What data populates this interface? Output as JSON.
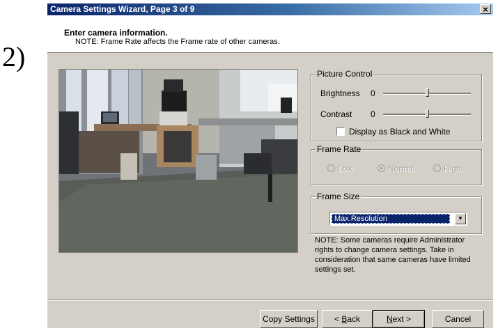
{
  "step_label": "2)",
  "window": {
    "title": "Camera Settings Wizard, Page 3 of 9",
    "close_glyph": "×"
  },
  "header": {
    "heading": "Enter camera information.",
    "note": "NOTE: Frame Rate affects the Frame rate of other cameras."
  },
  "picture_control": {
    "legend": "Picture Control",
    "brightness_label": "Brightness",
    "brightness_value": "0",
    "brightness_level": 0.5,
    "contrast_label": "Contrast",
    "contrast_value": "0",
    "contrast_level": 0.5,
    "bw_label": "Display as Black and White",
    "bw_checked": false
  },
  "frame_rate": {
    "legend": "Frame Rate",
    "options": [
      {
        "label": "Low",
        "checked": false
      },
      {
        "label": "Normal",
        "checked": true
      },
      {
        "label": "High",
        "checked": false
      }
    ]
  },
  "frame_size": {
    "legend": "Frame Size",
    "selected": "Max.Resolution"
  },
  "note": "NOTE: Some cameras require Administrator rights to change camera settings. Take in consideration that same cameras have limited settings set.",
  "buttons": {
    "copy_settings": "Copy Settings",
    "back_prefix": "< ",
    "back_accel": "B",
    "back_rest": "ack",
    "next_accel": "N",
    "next_rest": "ext >",
    "cancel": "Cancel"
  },
  "colors": {
    "dialog_bg": "#d4d0c8",
    "titlebar": "#0a246a",
    "selection": "#0a246a"
  }
}
